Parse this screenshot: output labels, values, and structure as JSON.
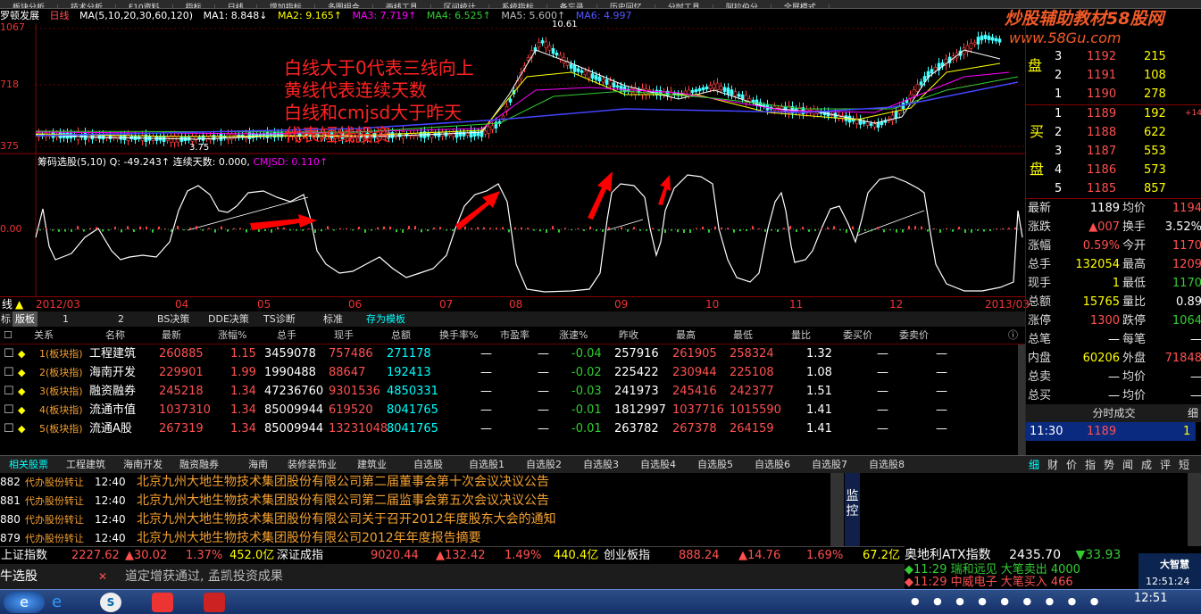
{
  "menu": [
    "板块分析",
    "技术分析",
    "F10资料",
    "指标",
    "日线",
    "增加指标",
    "多图组合",
    "画线工具",
    "区间统计",
    "系统指标",
    "备忘录",
    "历史回忆",
    "分时工具",
    "阿拉伯分",
    "全屏模式"
  ],
  "watermark": {
    "line1": "炒股辅助教材58股网",
    "line2": "www.58Gu.com"
  },
  "chart": {
    "stock": "罗顿发展",
    "period": "日线",
    "ma_label": "MA(5,10,20,30,60,120)",
    "ma1": "MA1: 8.848↓",
    "ma2": "MA2: 9.165↑",
    "ma3": "MA3: 7.719↑",
    "ma4": "MA4: 6.525↑",
    "ma5": "MA5: 5.600↑",
    "ma6": "MA6: 4.997",
    "price_axis": [
      "1067",
      "718",
      "375"
    ],
    "high_label": "10.61",
    "low_label": "3.75",
    "annotations": [
      "白线大于0代表三线向上",
      "黄线代表连续天数",
      "白线和cmjsd大于昨天",
      "代表短线投资"
    ],
    "indicator": {
      "name": "筹码选股(5,10)",
      "q": "Q: -49.243↑",
      "days": "连续天数: 0.000,",
      "cmjsd": "CMJSD: 0.110↑",
      "zero": "0.00"
    },
    "dates": [
      "线",
      "2012/03",
      "04",
      "05",
      "06",
      "07",
      "08",
      "09",
      "10",
      "11",
      "12",
      "2013/03"
    ]
  },
  "tabs1": [
    "标",
    "版板",
    "1",
    "2",
    "BS决策",
    "DDE决策",
    "TS诊断",
    "标准",
    "存为模板"
  ],
  "table": {
    "headers": [
      "关系",
      "名称",
      "最新",
      "涨幅%",
      "总手",
      "现手",
      "总额",
      "换手率%",
      "市盈率",
      "涨速%",
      "昨收",
      "最高",
      "最低",
      "量比",
      "委买价",
      "委卖价"
    ],
    "rows": [
      {
        "rel": "1(板块指)",
        "name": "工程建筑",
        "last": "260885",
        "pct": "1.15",
        "vol": "3459078",
        "cur": "757486",
        "amt": "271178",
        "turn": "—",
        "pe": "—",
        "spd": "-0.04",
        "prev": "257916",
        "high": "261905",
        "low": "258324",
        "vr": "1.32",
        "bid": "—",
        "ask": "—"
      },
      {
        "rel": "2(板块指)",
        "name": "海南开发",
        "last": "229901",
        "pct": "1.99",
        "vol": "1990488",
        "cur": "88647",
        "amt": "192413",
        "turn": "—",
        "pe": "—",
        "spd": "-0.02",
        "prev": "225422",
        "high": "230944",
        "low": "225108",
        "vr": "1.08",
        "bid": "—",
        "ask": "—"
      },
      {
        "rel": "3(板块指)",
        "name": "融资融券",
        "last": "245218",
        "pct": "1.34",
        "vol": "47236760",
        "cur": "9301536",
        "amt": "4850331",
        "turn": "—",
        "pe": "—",
        "spd": "-0.03",
        "prev": "241973",
        "high": "245416",
        "low": "242377",
        "vr": "1.51",
        "bid": "—",
        "ask": "—"
      },
      {
        "rel": "4(板块指)",
        "name": "流通市值",
        "last": "1037310",
        "pct": "1.34",
        "vol": "85009944",
        "cur": "619520",
        "amt": "8041765",
        "turn": "—",
        "pe": "—",
        "spd": "-0.01",
        "prev": "1812997",
        "high": "1037716",
        "low": "1015590",
        "vr": "1.41",
        "bid": "—",
        "ask": "—"
      },
      {
        "rel": "5(板块指)",
        "name": "流通A股",
        "last": "267319",
        "pct": "1.34",
        "vol": "85009944",
        "cur": "13231048",
        "amt": "8041765",
        "turn": "—",
        "pe": "—",
        "spd": "-0.01",
        "prev": "263782",
        "high": "267378",
        "low": "264159",
        "vr": "1.41",
        "bid": "—",
        "ask": "—"
      }
    ]
  },
  "tabs2": [
    "相关股票",
    "工程建筑",
    "海南开发",
    "融资融券",
    "海南",
    "装修装饰业",
    "建筑业",
    "自选股",
    "自选股1",
    "自选股2",
    "自选股3",
    "自选股4",
    "自选股5",
    "自选股6",
    "自选股7",
    "自选股8"
  ],
  "news": [
    {
      "id": "882",
      "tag": "代办股份转让",
      "time": "12:40",
      "text": "北京九州大地生物技术集团股份有限公司第二届董事会第十次会议决议公告"
    },
    {
      "id": "881",
      "tag": "代办股份转让",
      "time": "12:40",
      "text": "北京九州大地生物技术集团股份有限公司第二届监事会第五次会议决议公告"
    },
    {
      "id": "880",
      "tag": "代办股份转让",
      "time": "12:40",
      "text": "北京九州大地生物技术集团股份有限公司关于召开2012年度股东大会的通知"
    },
    {
      "id": "879",
      "tag": "代办股份转让",
      "time": "12:40",
      "text": "北京九州大地生物技术集团股份有限公司2012年年度报告摘要"
    }
  ],
  "monitor": "监控",
  "index_bar": {
    "sh": "上证指数",
    "sh_val": "2227.62",
    "sh_chg": "▲30.02",
    "sh_pct": "1.37%",
    "sh_amt": "452.0亿",
    "sz": "深证成指",
    "sz_val": "9020.44",
    "sz_chg": "▲132.42",
    "sz_pct": "1.49%",
    "sz_amt": "440.4亿",
    "cy": "创业板指",
    "cy_val": "888.24",
    "cy_chg": "▲14.76",
    "cy_pct": "1.69%",
    "cy_amt": "67.2亿",
    "at": "奥地利ATX指数",
    "at_val": "2435.70",
    "at_chg": "▼33.93"
  },
  "status": {
    "left": "牛选股",
    "marquee": "道定增获通过, 孟凯投资成果"
  },
  "alerts": [
    {
      "text": "◆11:29 瑞和远见 大笔卖出 4000"
    },
    {
      "text": "◆11:29 中威电子 大笔买入 466"
    }
  ],
  "brand": "大智慧",
  "clock": "12:51:24",
  "taskbar_clock": "12:51",
  "right": {
    "sell_label": "盘",
    "buy_label1": "买",
    "buy_label2": "盘",
    "asks": [
      [
        "3",
        "1192",
        "215"
      ],
      [
        "2",
        "1191",
        "108"
      ],
      [
        "1",
        "1190",
        "278"
      ]
    ],
    "bids": [
      [
        "1",
        "1189",
        "192",
        "+14"
      ],
      [
        "2",
        "1188",
        "622"
      ],
      [
        "3",
        "1187",
        "553"
      ],
      [
        "4",
        "1186",
        "573"
      ],
      [
        "5",
        "1185",
        "857"
      ]
    ],
    "stats": [
      [
        "最新",
        "1189",
        "均价",
        "1194"
      ],
      [
        "涨跌",
        "▲007",
        "换手",
        "3.52%"
      ],
      [
        "涨幅",
        "0.59%",
        "今开",
        "1170"
      ],
      [
        "总手",
        "132054",
        "最高",
        "1209"
      ],
      [
        "现手",
        "1",
        "最低",
        "1170"
      ],
      [
        "总额",
        "15765",
        "量比",
        "0.89"
      ],
      [
        "涨停",
        "1300",
        "跌停",
        "1064"
      ],
      [
        "总笔",
        "—",
        "每笔",
        "—"
      ],
      [
        "内盘",
        "60206",
        "外盘",
        "71848"
      ],
      [
        "总卖",
        "—",
        "均价",
        "—"
      ],
      [
        "总买",
        "—",
        "均价",
        "—"
      ]
    ],
    "tick_header": "分时成交",
    "tick_btn": "细",
    "tick": {
      "time": "11:30",
      "price": "1189",
      "vol": "1"
    },
    "btabs": [
      "细",
      "财",
      "价",
      "指",
      "势",
      "闻",
      "成",
      "评",
      "短"
    ]
  }
}
